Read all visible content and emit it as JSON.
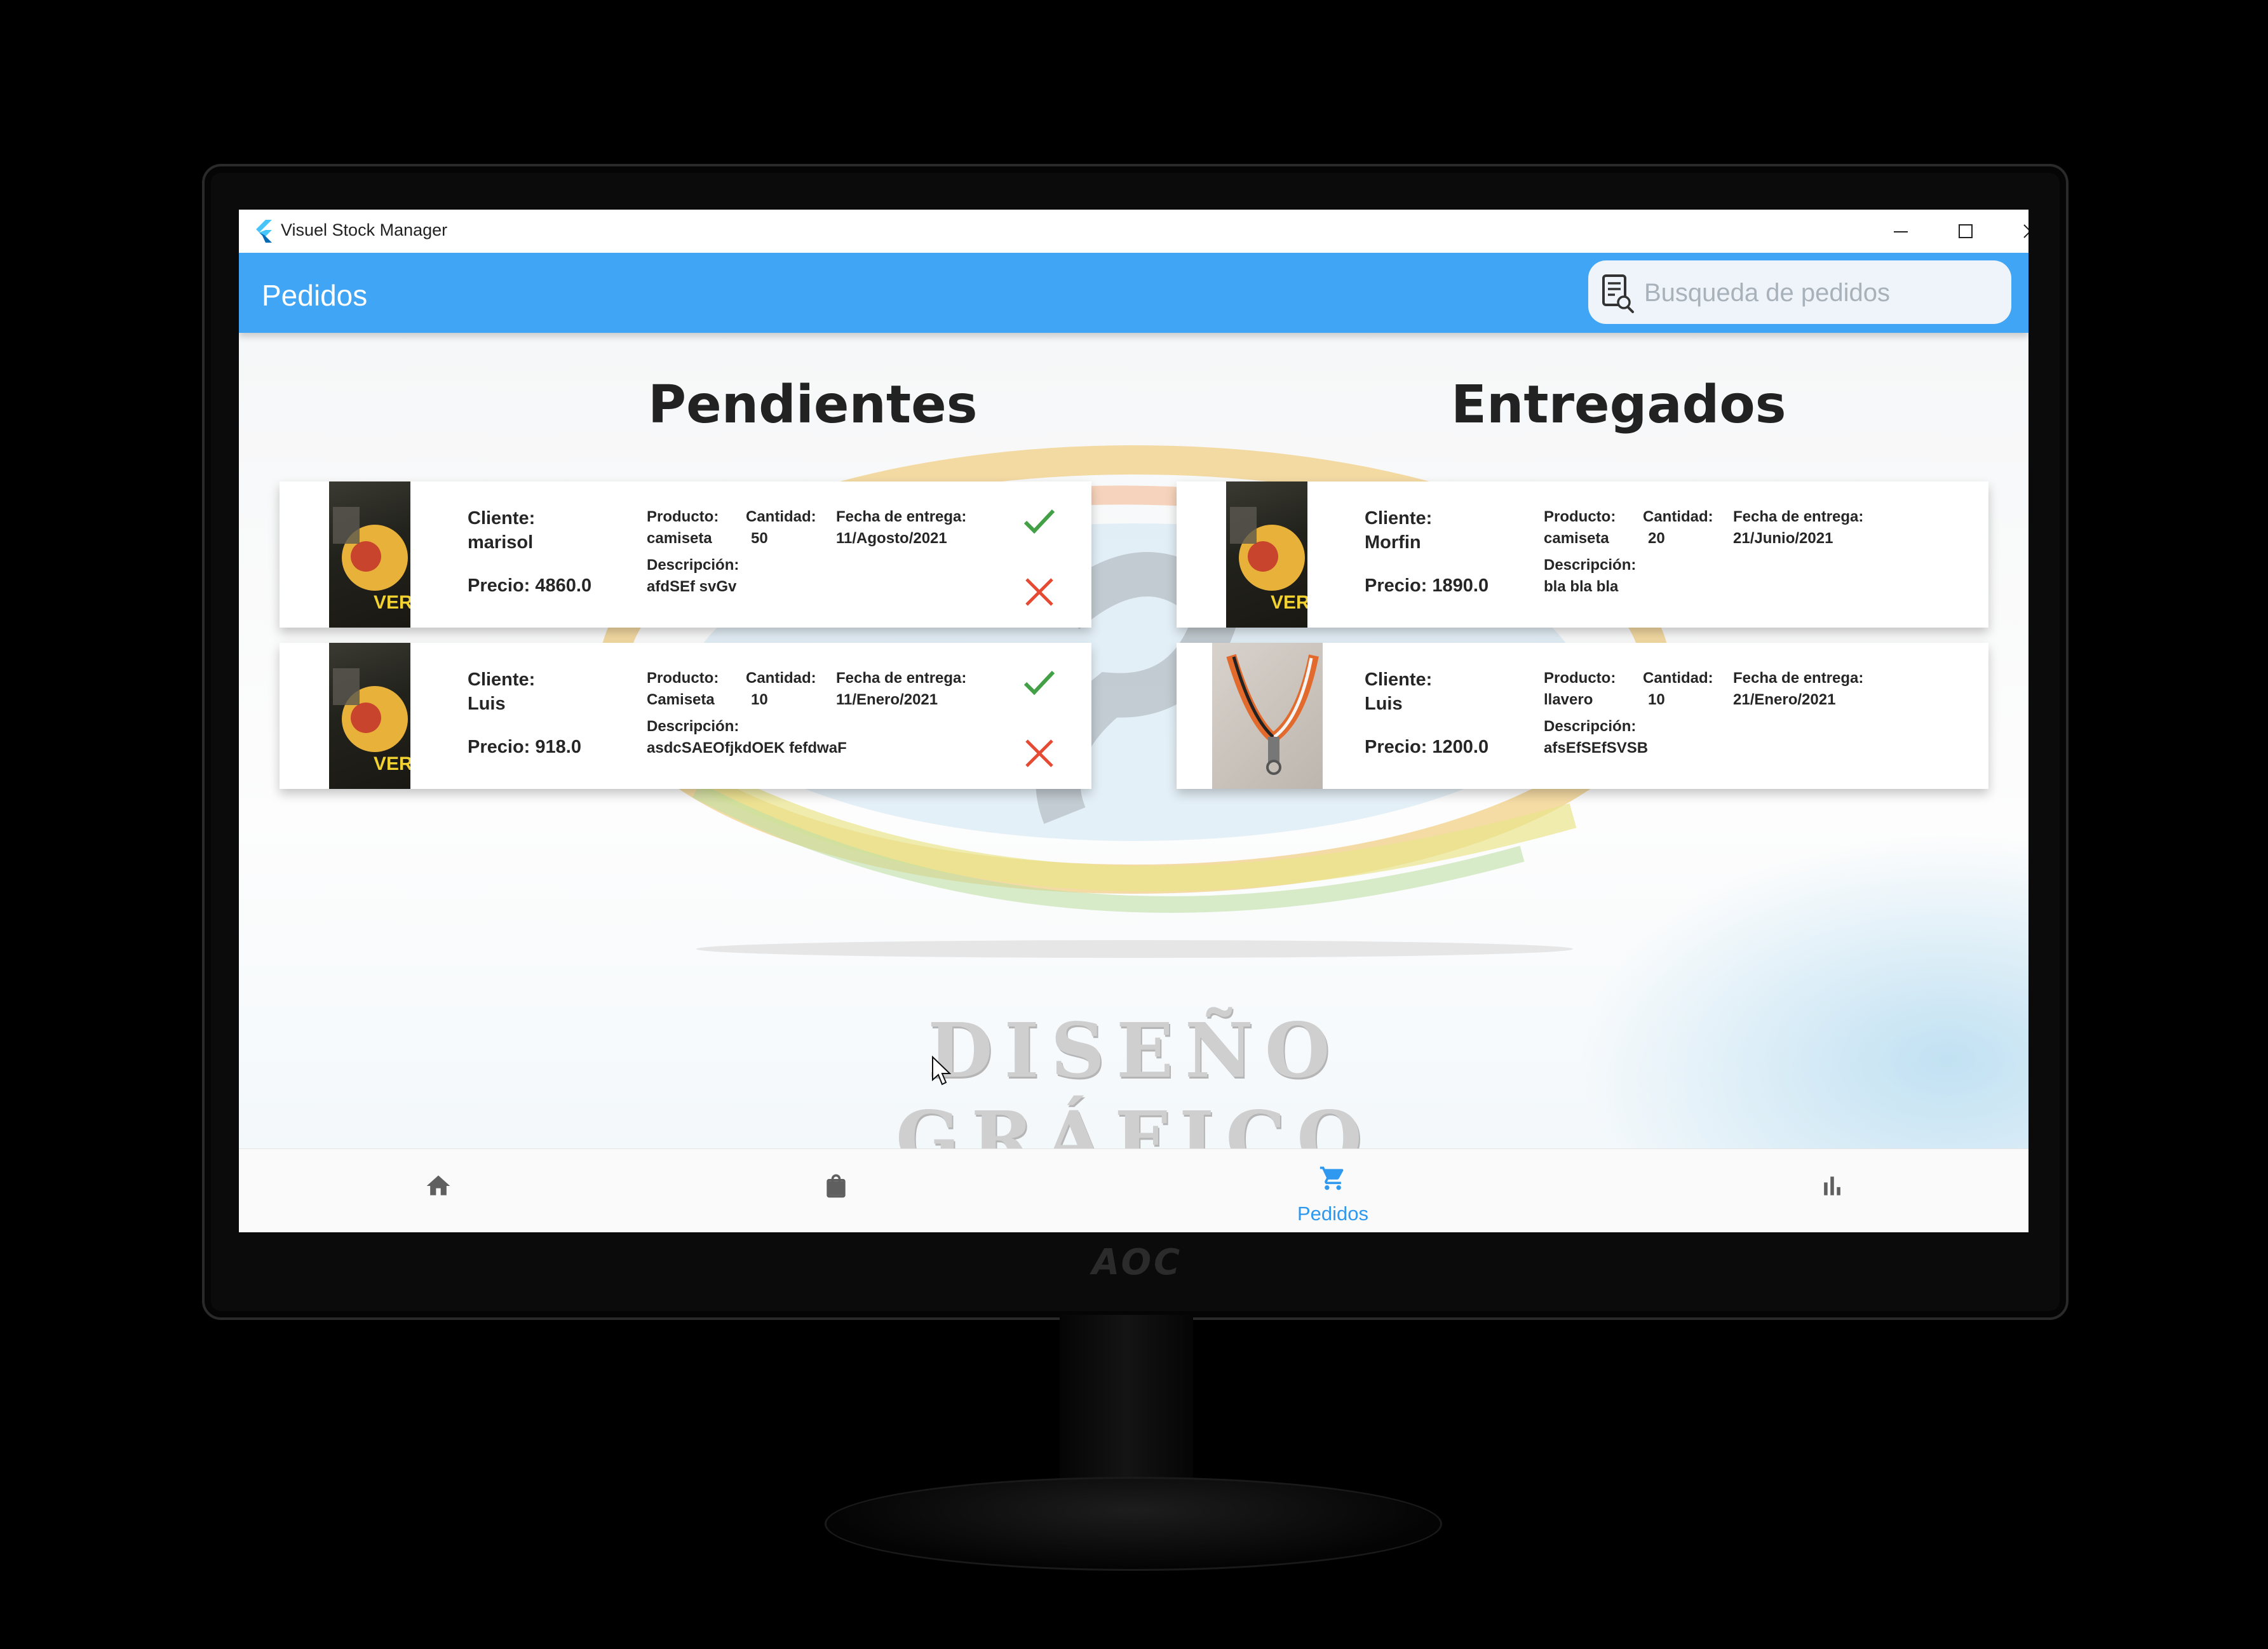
{
  "window": {
    "title": "Visuel Stock Manager"
  },
  "appbar": {
    "title": "Pedidos",
    "search_placeholder": "Busqueda de pedidos"
  },
  "background": {
    "watermark": "DISEÑO GRÁFICO"
  },
  "labels": {
    "cliente": "Cliente:",
    "producto": "Producto:",
    "cantidad": "Cantidad:",
    "fecha": "Fecha de entrega:",
    "descripcion": "Descripción:"
  },
  "pending": {
    "title": "Pendientes",
    "orders": [
      {
        "cliente": "marisol",
        "precio": "Precio: 4860.0",
        "producto": "camiseta",
        "cantidad": "50",
        "fecha": "11/Agosto/2021",
        "descripcion": "afdSEf svGv"
      },
      {
        "cliente": "Luis",
        "precio": "Precio: 918.0",
        "producto": "Camiseta",
        "cantidad": "10",
        "fecha": "11/Enero/2021",
        "descripcion": "asdcSAEOfjkdOEK fefdwaF"
      }
    ]
  },
  "delivered": {
    "title": "Entregados",
    "orders": [
      {
        "cliente": "Morfin",
        "precio": "Precio: 1890.0",
        "producto": "camiseta",
        "cantidad": "20",
        "fecha": "21/Junio/2021",
        "descripcion": "bla bla bla"
      },
      {
        "cliente": "Luis",
        "precio": "Precio: 1200.0",
        "producto": "llavero",
        "cantidad": "10",
        "fecha": "21/Enero/2021",
        "descripcion": "afsEfSEfSVSB"
      }
    ]
  },
  "bottom_nav": {
    "items": [
      {
        "icon": "home-icon"
      },
      {
        "icon": "shopping-bag-icon"
      },
      {
        "icon": "shopping-cart-icon",
        "label": "Pedidos",
        "active": true
      },
      {
        "icon": "bar-chart-icon"
      }
    ]
  },
  "colors": {
    "appbar": "#41a5f5",
    "accept": "#43a047",
    "reject": "#e64a33",
    "nav_active": "#2f98ef",
    "nav_inactive": "#5f5f5f"
  },
  "monitor": {
    "brand": "AOC"
  }
}
